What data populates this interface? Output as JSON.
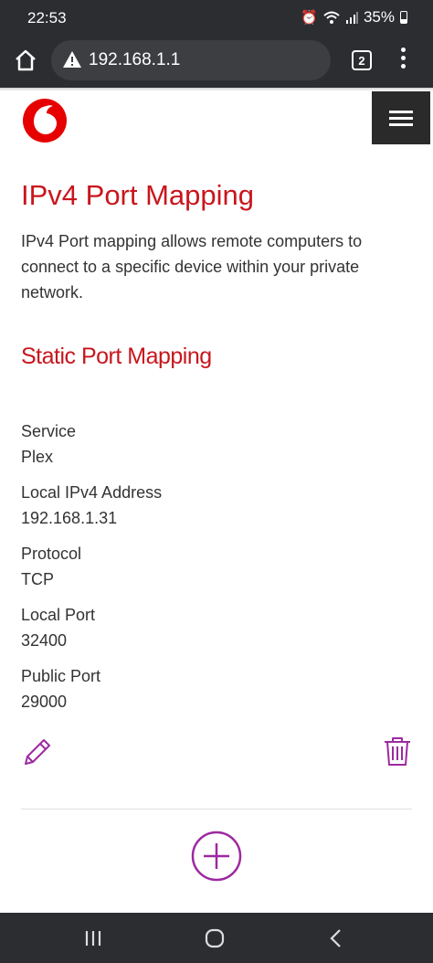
{
  "status_bar": {
    "time": "22:53",
    "battery": "35%"
  },
  "browser": {
    "url": "192.168.1.1",
    "tab_count": "2"
  },
  "page": {
    "title": "IPv4 Port Mapping",
    "intro": "IPv4 Port mapping allows remote computers to connect to a specific device within your private network.",
    "section_title": "Static Port Mapping",
    "mapping": {
      "service_label": "Service",
      "service_value": "Plex",
      "address_label": "Local IPv4 Address",
      "address_value": "192.168.1.31",
      "protocol_label": "Protocol",
      "protocol_value": "TCP",
      "local_port_label": "Local Port",
      "local_port_value": "32400",
      "public_port_label": "Public Port",
      "public_port_value": "29000"
    }
  },
  "colors": {
    "brand_red": "#c8161d",
    "action_purple": "#9c2aa0",
    "dark_bar": "#2b2d30"
  },
  "icons": [
    "home-icon",
    "warning-icon",
    "tabs-icon",
    "more-vert-icon",
    "vodafone-logo",
    "hamburger-icon",
    "pencil-icon",
    "trash-icon",
    "plus-circle-icon",
    "recent-apps-icon",
    "home-nav-icon",
    "back-icon"
  ]
}
